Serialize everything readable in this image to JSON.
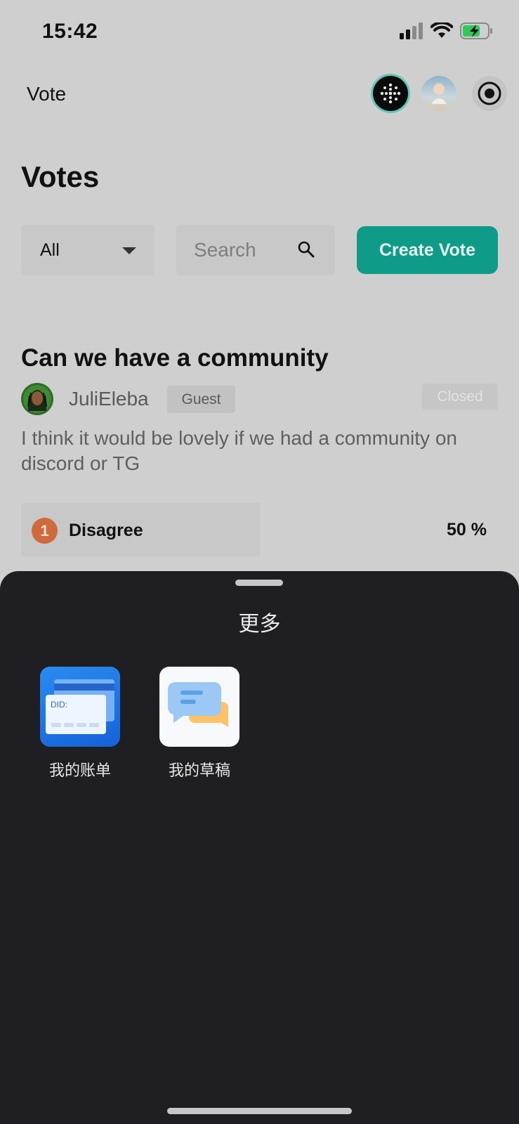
{
  "status_bar": {
    "time": "15:42"
  },
  "nav": {
    "title": "Vote"
  },
  "page": {
    "title": "Votes"
  },
  "filter": {
    "selected": "All"
  },
  "search": {
    "placeholder": "Search"
  },
  "actions": {
    "create_label": "Create Vote"
  },
  "vote": {
    "title": "Can we have a community",
    "author": "JuliEleba",
    "role_badge": "Guest",
    "status_badge": "Closed",
    "description": "I think it would be lovely if we had a community on discord or TG",
    "options": [
      {
        "index": "1",
        "label": "Disagree",
        "percent": "50 %"
      }
    ]
  },
  "sheet": {
    "title": "更多",
    "items": [
      {
        "label": "我的账单",
        "icon": "bill-card-icon",
        "card_text": "DID:"
      },
      {
        "label": "我的草稿",
        "icon": "draft-chat-icon"
      }
    ]
  },
  "colors": {
    "accent": "#0e9b88",
    "sheet_bg": "#1f1e22",
    "option_badge": "#d06a3d"
  }
}
